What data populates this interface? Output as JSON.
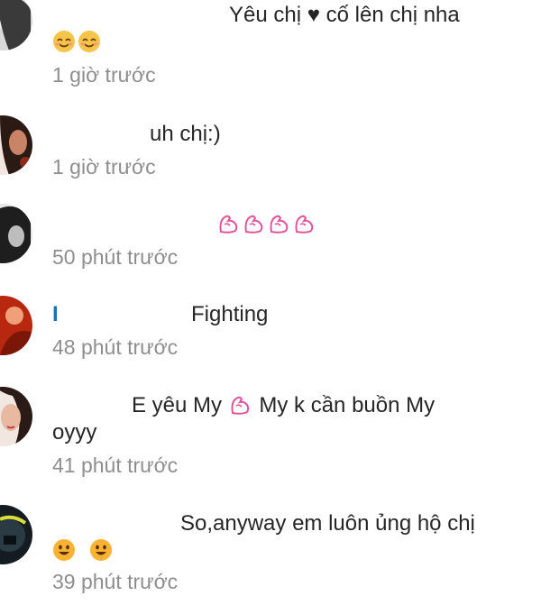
{
  "comments": [
    {
      "text": "Yêu chị ♥ cố lên chị nha",
      "time": "1 giờ trước"
    },
    {
      "text": "uh chị:)",
      "time": "1 giờ trước"
    },
    {
      "time": "50 phút trước"
    },
    {
      "text": "Fighting",
      "time": "48 phút trước"
    },
    {
      "text": "E yêu My",
      "text_after": "My k cần buồn My",
      "text_line2": "oyyy",
      "time": "41 phút trước"
    },
    {
      "text": "So,anyway em luôn ủng hộ chị",
      "time": "39 phút trước"
    }
  ],
  "icons": {
    "smile": "smiling-face-emoji",
    "muscle": "flexed-biceps-emoji",
    "joy": "happy-face-emoji"
  },
  "colors": {
    "text": "#262626",
    "time": "#8e8e8e",
    "username": "#1f6fb4",
    "muscle_emoji": "#e0559a"
  }
}
